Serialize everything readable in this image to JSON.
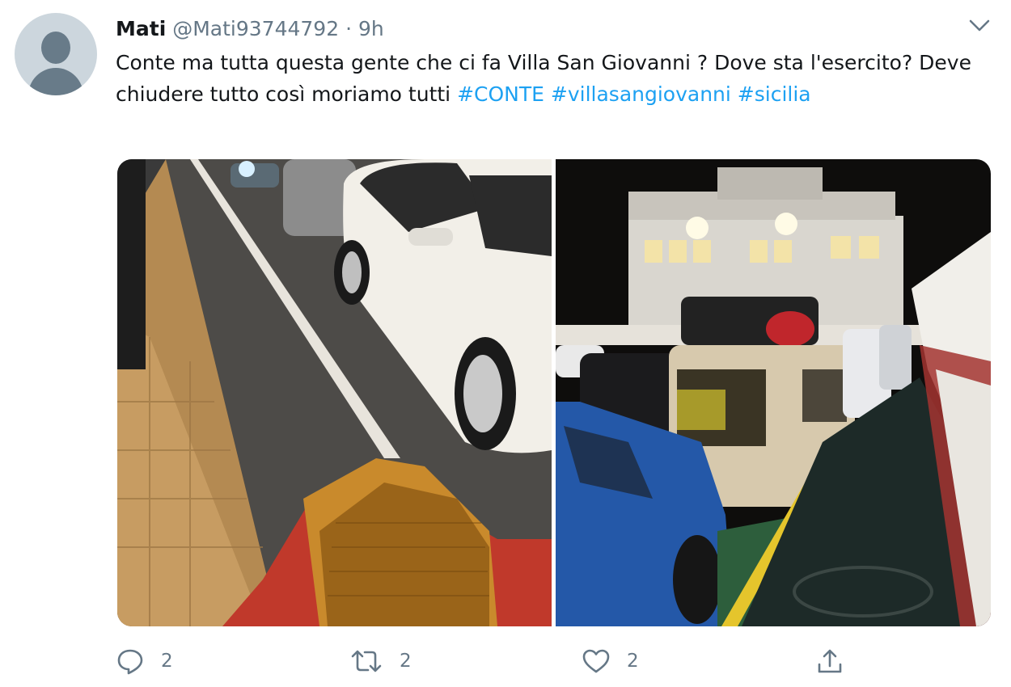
{
  "author": {
    "name": "Mati",
    "handle": "@Mati93744792",
    "separator": "·",
    "time": "9h",
    "avatar_icon": "default-avatar-icon"
  },
  "tweet": {
    "text_part1": "Conte ma tutta questa gente che ci fa Villa San Giovanni ? Dove sta l'esercito? Deve chiudere tutto così moriamo tutti ",
    "hashtags": [
      "#CONTE",
      "#villasangiovanni",
      "#sicilia"
    ]
  },
  "media": {
    "photo1_description_icon": "photo-night-street-cars",
    "photo2_description_icon": "photo-ferry-deck-cars"
  },
  "actions": {
    "reply_count": "2",
    "retweet_count": "2",
    "like_count": "2"
  },
  "colors": {
    "link": "#1da1f2",
    "muted": "#657786",
    "text": "#14171a"
  }
}
